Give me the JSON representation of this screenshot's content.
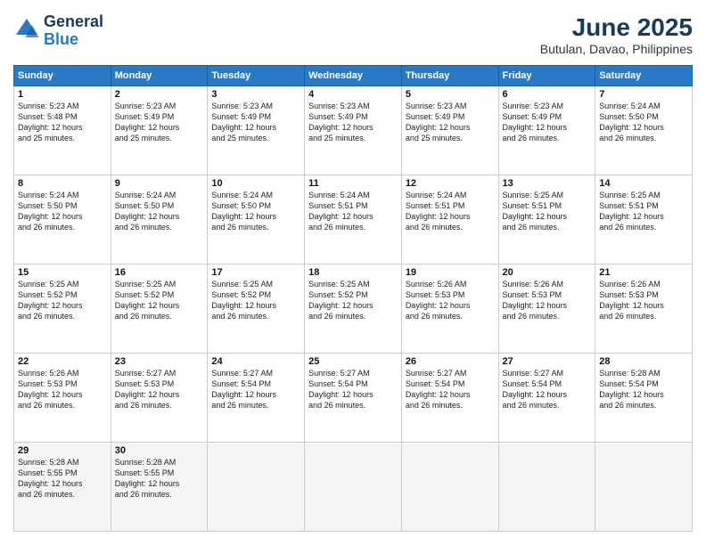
{
  "header": {
    "logo_general": "General",
    "logo_blue": "Blue",
    "month_year": "June 2025",
    "location": "Butulan, Davao, Philippines"
  },
  "weekdays": [
    "Sunday",
    "Monday",
    "Tuesday",
    "Wednesday",
    "Thursday",
    "Friday",
    "Saturday"
  ],
  "weeks": [
    [
      {
        "day": "1",
        "lines": [
          "Sunrise: 5:23 AM",
          "Sunset: 5:48 PM",
          "Daylight: 12 hours",
          "and 25 minutes."
        ]
      },
      {
        "day": "2",
        "lines": [
          "Sunrise: 5:23 AM",
          "Sunset: 5:49 PM",
          "Daylight: 12 hours",
          "and 25 minutes."
        ]
      },
      {
        "day": "3",
        "lines": [
          "Sunrise: 5:23 AM",
          "Sunset: 5:49 PM",
          "Daylight: 12 hours",
          "and 25 minutes."
        ]
      },
      {
        "day": "4",
        "lines": [
          "Sunrise: 5:23 AM",
          "Sunset: 5:49 PM",
          "Daylight: 12 hours",
          "and 25 minutes."
        ]
      },
      {
        "day": "5",
        "lines": [
          "Sunrise: 5:23 AM",
          "Sunset: 5:49 PM",
          "Daylight: 12 hours",
          "and 25 minutes."
        ]
      },
      {
        "day": "6",
        "lines": [
          "Sunrise: 5:23 AM",
          "Sunset: 5:49 PM",
          "Daylight: 12 hours",
          "and 26 minutes."
        ]
      },
      {
        "day": "7",
        "lines": [
          "Sunrise: 5:24 AM",
          "Sunset: 5:50 PM",
          "Daylight: 12 hours",
          "and 26 minutes."
        ]
      }
    ],
    [
      {
        "day": "8",
        "lines": [
          "Sunrise: 5:24 AM",
          "Sunset: 5:50 PM",
          "Daylight: 12 hours",
          "and 26 minutes."
        ]
      },
      {
        "day": "9",
        "lines": [
          "Sunrise: 5:24 AM",
          "Sunset: 5:50 PM",
          "Daylight: 12 hours",
          "and 26 minutes."
        ]
      },
      {
        "day": "10",
        "lines": [
          "Sunrise: 5:24 AM",
          "Sunset: 5:50 PM",
          "Daylight: 12 hours",
          "and 26 minutes."
        ]
      },
      {
        "day": "11",
        "lines": [
          "Sunrise: 5:24 AM",
          "Sunset: 5:51 PM",
          "Daylight: 12 hours",
          "and 26 minutes."
        ]
      },
      {
        "day": "12",
        "lines": [
          "Sunrise: 5:24 AM",
          "Sunset: 5:51 PM",
          "Daylight: 12 hours",
          "and 26 minutes."
        ]
      },
      {
        "day": "13",
        "lines": [
          "Sunrise: 5:25 AM",
          "Sunset: 5:51 PM",
          "Daylight: 12 hours",
          "and 26 minutes."
        ]
      },
      {
        "day": "14",
        "lines": [
          "Sunrise: 5:25 AM",
          "Sunset: 5:51 PM",
          "Daylight: 12 hours",
          "and 26 minutes."
        ]
      }
    ],
    [
      {
        "day": "15",
        "lines": [
          "Sunrise: 5:25 AM",
          "Sunset: 5:52 PM",
          "Daylight: 12 hours",
          "and 26 minutes."
        ]
      },
      {
        "day": "16",
        "lines": [
          "Sunrise: 5:25 AM",
          "Sunset: 5:52 PM",
          "Daylight: 12 hours",
          "and 26 minutes."
        ]
      },
      {
        "day": "17",
        "lines": [
          "Sunrise: 5:25 AM",
          "Sunset: 5:52 PM",
          "Daylight: 12 hours",
          "and 26 minutes."
        ]
      },
      {
        "day": "18",
        "lines": [
          "Sunrise: 5:25 AM",
          "Sunset: 5:52 PM",
          "Daylight: 12 hours",
          "and 26 minutes."
        ]
      },
      {
        "day": "19",
        "lines": [
          "Sunrise: 5:26 AM",
          "Sunset: 5:53 PM",
          "Daylight: 12 hours",
          "and 26 minutes."
        ]
      },
      {
        "day": "20",
        "lines": [
          "Sunrise: 5:26 AM",
          "Sunset: 5:53 PM",
          "Daylight: 12 hours",
          "and 26 minutes."
        ]
      },
      {
        "day": "21",
        "lines": [
          "Sunrise: 5:26 AM",
          "Sunset: 5:53 PM",
          "Daylight: 12 hours",
          "and 26 minutes."
        ]
      }
    ],
    [
      {
        "day": "22",
        "lines": [
          "Sunrise: 5:26 AM",
          "Sunset: 5:53 PM",
          "Daylight: 12 hours",
          "and 26 minutes."
        ]
      },
      {
        "day": "23",
        "lines": [
          "Sunrise: 5:27 AM",
          "Sunset: 5:53 PM",
          "Daylight: 12 hours",
          "and 26 minutes."
        ]
      },
      {
        "day": "24",
        "lines": [
          "Sunrise: 5:27 AM",
          "Sunset: 5:54 PM",
          "Daylight: 12 hours",
          "and 26 minutes."
        ]
      },
      {
        "day": "25",
        "lines": [
          "Sunrise: 5:27 AM",
          "Sunset: 5:54 PM",
          "Daylight: 12 hours",
          "and 26 minutes."
        ]
      },
      {
        "day": "26",
        "lines": [
          "Sunrise: 5:27 AM",
          "Sunset: 5:54 PM",
          "Daylight: 12 hours",
          "and 26 minutes."
        ]
      },
      {
        "day": "27",
        "lines": [
          "Sunrise: 5:27 AM",
          "Sunset: 5:54 PM",
          "Daylight: 12 hours",
          "and 26 minutes."
        ]
      },
      {
        "day": "28",
        "lines": [
          "Sunrise: 5:28 AM",
          "Sunset: 5:54 PM",
          "Daylight: 12 hours",
          "and 26 minutes."
        ]
      }
    ],
    [
      {
        "day": "29",
        "lines": [
          "Sunrise: 5:28 AM",
          "Sunset: 5:55 PM",
          "Daylight: 12 hours",
          "and 26 minutes."
        ]
      },
      {
        "day": "30",
        "lines": [
          "Sunrise: 5:28 AM",
          "Sunset: 5:55 PM",
          "Daylight: 12 hours",
          "and 26 minutes."
        ]
      },
      {
        "day": "",
        "lines": []
      },
      {
        "day": "",
        "lines": []
      },
      {
        "day": "",
        "lines": []
      },
      {
        "day": "",
        "lines": []
      },
      {
        "day": "",
        "lines": []
      }
    ]
  ]
}
